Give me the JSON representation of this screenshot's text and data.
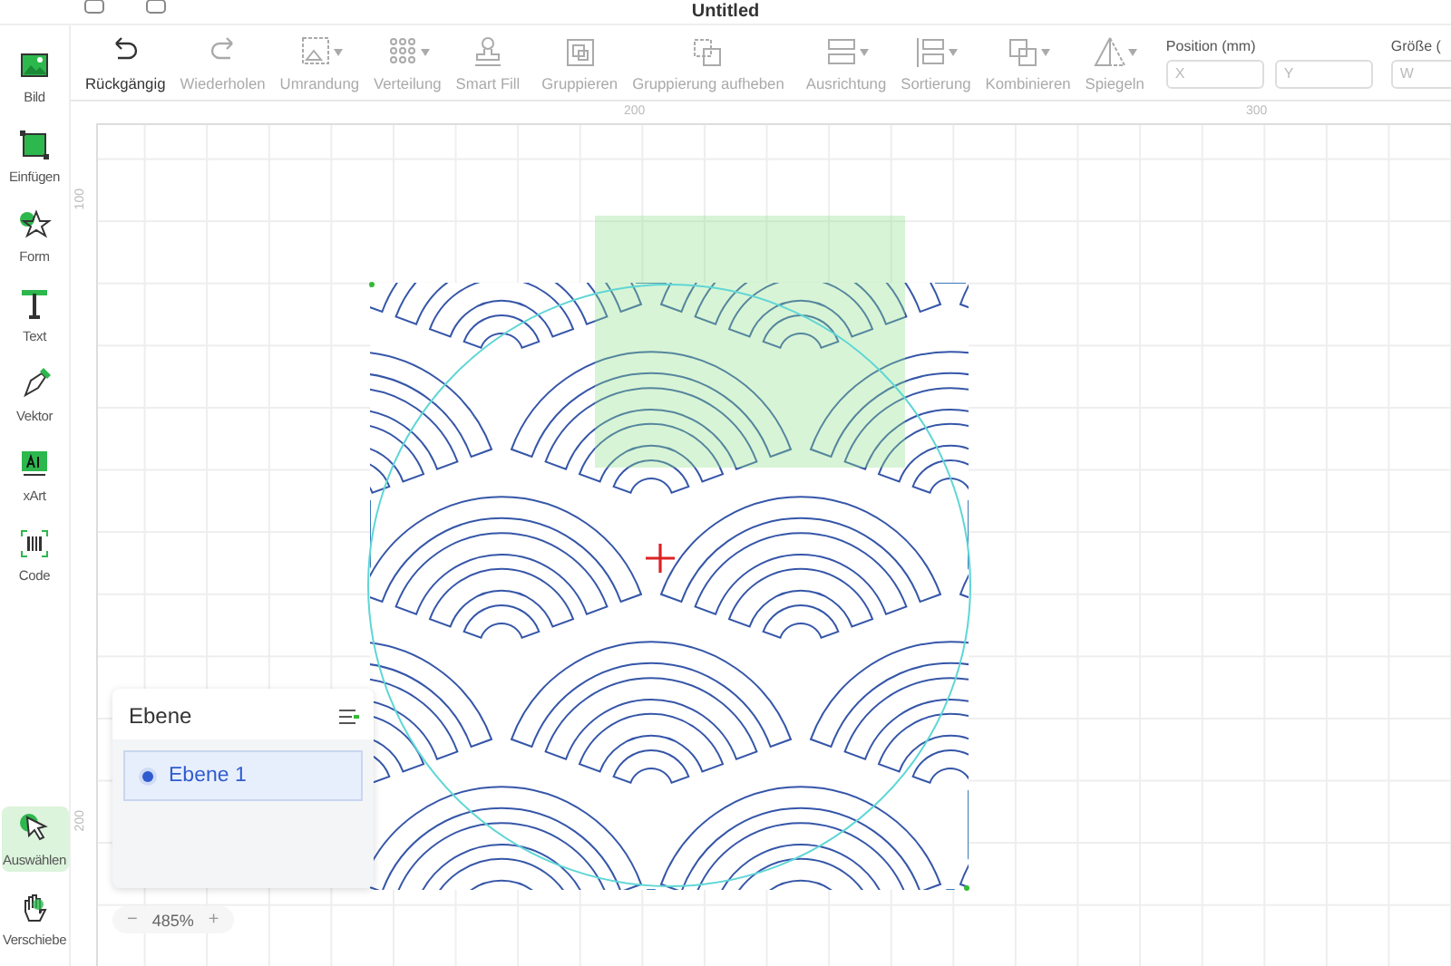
{
  "window": {
    "title": "Untitled"
  },
  "sidebar": {
    "items": [
      {
        "label": "Bild",
        "kind": "image",
        "selected": false
      },
      {
        "label": "Einfügen",
        "kind": "insert",
        "selected": false
      },
      {
        "label": "Form",
        "kind": "shape",
        "selected": false
      },
      {
        "label": "Text",
        "kind": "text",
        "selected": false
      },
      {
        "label": "Vektor",
        "kind": "vector",
        "selected": false
      },
      {
        "label": "xArt",
        "kind": "ai",
        "selected": false
      },
      {
        "label": "Code",
        "kind": "code",
        "selected": false
      }
    ],
    "bottom_items": [
      {
        "label": "Auswählen",
        "kind": "select",
        "selected": true
      },
      {
        "label": "Verschiebe",
        "kind": "pan",
        "selected": false
      }
    ]
  },
  "toolbar": {
    "items": [
      {
        "label": "Rückgängig",
        "kind": "undo",
        "disabled": false,
        "dropdown": false
      },
      {
        "label": "Wiederholen",
        "kind": "redo",
        "disabled": true,
        "dropdown": false
      },
      {
        "label": "Umrandung",
        "kind": "outline",
        "disabled": true,
        "dropdown": true
      },
      {
        "label": "Verteilung",
        "kind": "distribute",
        "disabled": true,
        "dropdown": true
      },
      {
        "label": "Smart Fill",
        "kind": "fill",
        "disabled": true,
        "dropdown": false
      },
      {
        "label": "Gruppieren",
        "kind": "group",
        "disabled": true,
        "dropdown": false
      },
      {
        "label": "Gruppierung aufheben",
        "kind": "ungroup",
        "disabled": true,
        "dropdown": false
      },
      {
        "label": "Ausrichtung",
        "kind": "align",
        "disabled": true,
        "dropdown": true
      },
      {
        "label": "Sortierung",
        "kind": "sort",
        "disabled": true,
        "dropdown": true
      },
      {
        "label": "Kombinieren",
        "kind": "combine",
        "disabled": true,
        "dropdown": true
      },
      {
        "label": "Spiegeln",
        "kind": "mirror",
        "disabled": true,
        "dropdown": true
      }
    ],
    "position": {
      "label": "Position (mm)",
      "x_placeholder": "X",
      "y_placeholder": "Y"
    },
    "size": {
      "label": "Größe (",
      "w_placeholder": "W"
    }
  },
  "rulers": {
    "horizontal": [
      "200",
      "300"
    ],
    "vertical": [
      "100",
      "200"
    ]
  },
  "layers": {
    "title": "Ebene",
    "items": [
      {
        "name": "Ebene 1",
        "selected": true
      }
    ]
  },
  "zoom": {
    "minus": "−",
    "value": "485%",
    "plus": "+"
  }
}
